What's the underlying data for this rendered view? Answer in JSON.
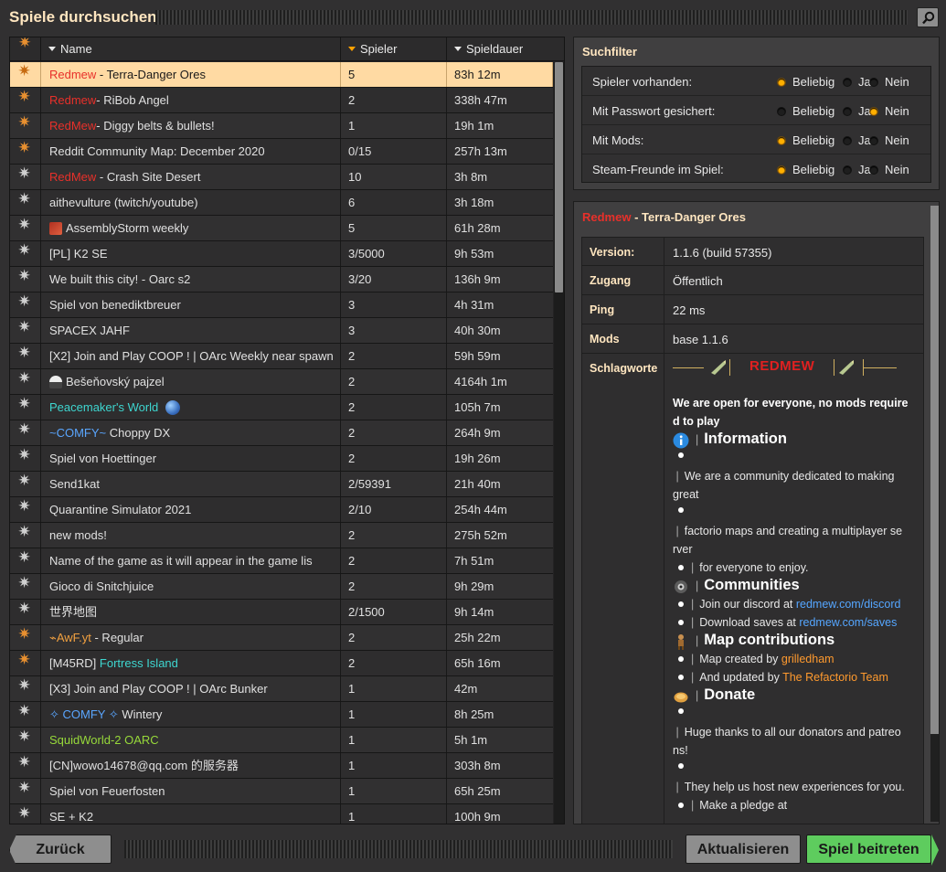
{
  "window": {
    "title": "Spiele durchsuchen"
  },
  "list": {
    "headers": {
      "name": "Name",
      "players": "Spieler",
      "time": "Spieldauer"
    },
    "rows": [
      {
        "prefix": "Redmew",
        "prefix_color": "red",
        "name": " - Terra-Danger Ores",
        "players": "5",
        "time": "83h 12m",
        "icon": "orange"
      },
      {
        "prefix": "Redmew",
        "prefix_color": "red",
        "name": "- RiBob Angel",
        "players": "2",
        "time": "338h 47m",
        "icon": "orange"
      },
      {
        "prefix": "RedMew",
        "prefix_color": "red",
        "name": "- Diggy belts & bullets!",
        "players": "1",
        "time": "19h 1m",
        "icon": "orange"
      },
      {
        "prefix": "",
        "prefix_color": "",
        "name": "Reddit Community Map: December 2020",
        "players": "0/15",
        "time": "257h 13m",
        "icon": "orange"
      },
      {
        "prefix": "RedMew",
        "prefix_color": "red",
        "name": " - Crash Site Desert",
        "players": "10",
        "time": "3h 8m",
        "icon": "white"
      },
      {
        "prefix": "",
        "prefix_color": "",
        "name": "aithevulture (twitch/youtube)",
        "players": "6",
        "time": "3h 18m",
        "icon": "white"
      },
      {
        "prefix": "",
        "prefix_color": "",
        "name": "AssemblyStorm weekly",
        "players": "5",
        "time": "61h 28m",
        "icon": "white",
        "pre_icon": "chest"
      },
      {
        "prefix": "",
        "prefix_color": "",
        "name": "[PL] K2 SE",
        "players": "3/5000",
        "time": "9h 53m",
        "icon": "white"
      },
      {
        "prefix": "",
        "prefix_color": "",
        "name": "We built this city! - Oarc s2",
        "players": "3/20",
        "time": "136h 9m",
        "icon": "white"
      },
      {
        "prefix": "",
        "prefix_color": "",
        "name": "Spiel von benediktbreuer",
        "players": "3",
        "time": "4h 31m",
        "icon": "white"
      },
      {
        "prefix": "",
        "prefix_color": "",
        "name": "SPACEX JAHF",
        "players": "3",
        "time": "40h 30m",
        "icon": "white"
      },
      {
        "prefix": "",
        "prefix_color": "",
        "name": "[X2] Join and Play COOP ! | OArc Weekly near spawn",
        "players": "2",
        "time": "59h 59m",
        "icon": "white"
      },
      {
        "prefix": "",
        "prefix_color": "",
        "name": "Bešeňovský pajzel",
        "players": "2",
        "time": "4164h 1m",
        "icon": "white",
        "pre_icon": "pipe"
      },
      {
        "prefix": "Peacemaker's World",
        "prefix_color": "teal",
        "name": "",
        "players": "2",
        "time": "105h 7m",
        "icon": "white",
        "post_icon": "globe"
      },
      {
        "prefix": "~COMFY~",
        "prefix_color": "blue",
        "name": " Choppy DX",
        "players": "2",
        "time": "264h 9m",
        "icon": "white"
      },
      {
        "prefix": "",
        "prefix_color": "",
        "name": "Spiel von Hoettinger",
        "players": "2",
        "time": "19h 26m",
        "icon": "white"
      },
      {
        "prefix": "",
        "prefix_color": "",
        "name": "Send1kat",
        "players": "2/59391",
        "time": "21h 40m",
        "icon": "white"
      },
      {
        "prefix": "",
        "prefix_color": "",
        "name": "Quarantine Simulator 2021",
        "players": "2/10",
        "time": "254h 44m",
        "icon": "white"
      },
      {
        "prefix": "",
        "prefix_color": "",
        "name": "new mods!",
        "players": "2",
        "time": "275h 52m",
        "icon": "white"
      },
      {
        "prefix": "",
        "prefix_color": "",
        "name": "Name of the game as it will appear in the game lis",
        "players": "2",
        "time": "7h 51m",
        "icon": "white"
      },
      {
        "prefix": "",
        "prefix_color": "",
        "name": "Gioco di Snitchjuice",
        "players": "2",
        "time": "9h 29m",
        "icon": "white"
      },
      {
        "prefix": "",
        "prefix_color": "",
        "name": "世界地图",
        "players": "2/1500",
        "time": "9h 14m",
        "icon": "white"
      },
      {
        "prefix": "⌁AwF.yt",
        "prefix_color": "orange",
        "name": " - Regular",
        "players": "2",
        "time": "25h 22m",
        "icon": "orange"
      },
      {
        "prefix": " [M45RD] ",
        "prefix_color": "",
        "name": "Fortress Island",
        "players": "2",
        "time": "65h 16m",
        "icon": "orange",
        "name_color": "teal"
      },
      {
        "prefix": "",
        "prefix_color": "",
        "name": "[X3] Join and Play COOP ! | OArc Bunker",
        "players": "1",
        "time": "42m",
        "icon": "white"
      },
      {
        "prefix": "✧ COMFY ✧",
        "prefix_color": "blue",
        "name": " Wintery",
        "players": "1",
        "time": "8h 25m",
        "icon": "white"
      },
      {
        "prefix": "SquidWorld-2 OARC",
        "prefix_color": "green",
        "name": "",
        "players": "1",
        "time": "5h 1m",
        "icon": "white"
      },
      {
        "prefix": "",
        "prefix_color": "",
        "name": "[CN]wowo14678@qq.com 的服务器",
        "players": "1",
        "time": "303h 8m",
        "icon": "white"
      },
      {
        "prefix": "",
        "prefix_color": "",
        "name": "Spiel von Feuerfosten",
        "players": "1",
        "time": "65h 25m",
        "icon": "white"
      },
      {
        "prefix": "",
        "prefix_color": "",
        "name": "SE + K2",
        "players": "1",
        "time": "100h 9m",
        "icon": "white"
      }
    ]
  },
  "filter": {
    "title": "Suchfilter",
    "options": {
      "any": "Beliebig",
      "yes": "Ja",
      "no": "Nein"
    },
    "rows": [
      {
        "label": "Spieler vorhanden:",
        "selected": "any"
      },
      {
        "label": "Mit Passwort gesichert:",
        "selected": "no"
      },
      {
        "label": "Mit Mods:",
        "selected": "any"
      },
      {
        "label": "Steam-Freunde im Spiel:",
        "selected": "any"
      }
    ]
  },
  "details": {
    "title_prefix": "Redmew",
    "title_rest": " - Terra-Danger Ores",
    "version_key": "Version:",
    "version_val": "1.1.6 (build 57355)",
    "access_key": "Zugang",
    "access_val": "Öffentlich",
    "ping_key": "Ping",
    "ping_val": "22 ms",
    "mods_key": "Mods",
    "mods_val": "base 1.1.6",
    "tags_key": "Schlagworte",
    "tags": {
      "banner": "REDMEW",
      "open1": "We are open for everyone, no mods require",
      "open2": "d to play",
      "h_info": "Information",
      "l1": "We are a community dedicated to making",
      "l1b": "great",
      "l2": "factorio maps and creating a multiplayer se",
      "l2b": "rver",
      "l3": "for everyone to enjoy.",
      "h_comm": "Communities",
      "c1_text": "Join our discord at ",
      "c1_link": "redmew.com/discord",
      "c2_text": "Download saves at ",
      "c2_link": "redmew.com/saves",
      "h_map": "Map contributions",
      "m1_text": "Map created by ",
      "m1_name": "grilledham",
      "m2_text": "And updated by ",
      "m2_name": "The Refactorio Team",
      "h_donate": "Donate",
      "d1": "Huge thanks to all our donators and patreo",
      "d1b": "ns!",
      "d2": "They help us host new experiences for you.",
      "d3": "Make a pledge at"
    }
  },
  "buttons": {
    "back": "Zurück",
    "refresh": "Aktualisieren",
    "join": "Spiel beitreten"
  }
}
